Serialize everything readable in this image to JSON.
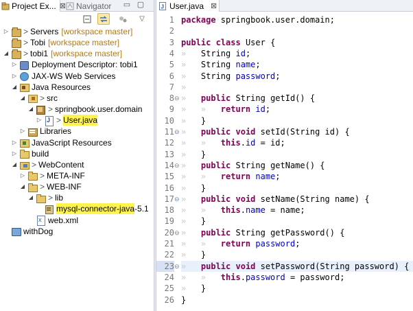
{
  "left_pane": {
    "tabs": [
      {
        "label": "Project Ex...",
        "close": "⊠"
      },
      {
        "label": "Navigator"
      }
    ],
    "window_controls": {
      "minimize": "▭",
      "maximize": "▢"
    },
    "toolbar": {
      "collapse_all": "⊟",
      "link_with_editor": "⇆",
      "menu": "▽"
    },
    "tree": [
      {
        "label": "Servers",
        "prefix": "> ",
        "suffix": "[workspace master]",
        "icon": "project-icon",
        "twisty": "▷",
        "depth": 0
      },
      {
        "label": "Tobi",
        "prefix": "> ",
        "suffix": "[workspace master]",
        "icon": "project-icon",
        "twisty": "",
        "depth": 0
      },
      {
        "label": "tobi1",
        "prefix": "> ",
        "suffix": "[workspace master]",
        "icon": "project-icon",
        "twisty": "◢",
        "depth": 0
      },
      {
        "label": "Deployment Descriptor: tobi1",
        "icon": "deployment-descriptor-icon",
        "twisty": "▷",
        "depth": 1
      },
      {
        "label": "JAX-WS Web Services",
        "icon": "web-services-icon",
        "twisty": "▷",
        "depth": 1
      },
      {
        "label": "Java Resources",
        "icon": "java-resources-icon",
        "twisty": "◢",
        "depth": 1
      },
      {
        "label": "src",
        "prefix": "> ",
        "icon": "source-folder-icon",
        "twisty": "◢",
        "depth": 2
      },
      {
        "label": "springbook.user.domain",
        "prefix": "> ",
        "icon": "package-icon",
        "twisty": "◢",
        "depth": 3
      },
      {
        "label": "User.java",
        "prefix": "> ",
        "icon": "java-file-icon",
        "twisty": "▷",
        "depth": 4,
        "highlight": true
      },
      {
        "label": "Libraries",
        "icon": "libraries-icon",
        "twisty": "▷",
        "depth": 2
      },
      {
        "label": "JavaScript Resources",
        "icon": "javascript-resources-icon",
        "twisty": "▷",
        "depth": 1
      },
      {
        "label": "build",
        "icon": "folder-icon",
        "twisty": "▷",
        "depth": 1
      },
      {
        "label": "WebContent",
        "prefix": "> ",
        "icon": "web-folder-icon",
        "twisty": "◢",
        "depth": 1
      },
      {
        "label": "META-INF",
        "prefix": "> ",
        "icon": "folder-icon",
        "twisty": "▷",
        "depth": 2
      },
      {
        "label": "WEB-INF",
        "prefix": "> ",
        "icon": "folder-icon",
        "twisty": "◢",
        "depth": 2
      },
      {
        "label": "lib",
        "prefix": "> ",
        "icon": "folder-icon",
        "twisty": "◢",
        "depth": 3
      },
      {
        "label": "mysql-connector-java",
        "suffix": "-5.1",
        "icon": "jar-icon",
        "twisty": "",
        "depth": 4,
        "highlight": true
      },
      {
        "label": "web.xml",
        "icon": "xml-file-icon",
        "twisty": "",
        "depth": 3
      },
      {
        "label": "withDog",
        "icon": "withdog-project-icon",
        "twisty": "",
        "depth": 0
      }
    ]
  },
  "editor": {
    "tab": {
      "label": "User.java",
      "close": "⊠"
    },
    "current_line": 23,
    "lines": [
      {
        "n": "1",
        "code": [
          [
            "kw",
            "package"
          ],
          [
            "",
            " springbook.user.domain;"
          ]
        ]
      },
      {
        "n": "2",
        "code": []
      },
      {
        "n": "3",
        "code": [
          [
            "kw",
            "public"
          ],
          [
            "",
            " "
          ],
          [
            "kw",
            "class"
          ],
          [
            "",
            " User {"
          ]
        ]
      },
      {
        "n": "4",
        "code": [
          [
            "ws",
            "»   "
          ],
          [
            "",
            "String "
          ],
          [
            "fd",
            "id"
          ],
          [
            "",
            ";"
          ]
        ]
      },
      {
        "n": "5",
        "code": [
          [
            "ws",
            "»   "
          ],
          [
            "",
            "String "
          ],
          [
            "fd",
            "name"
          ],
          [
            "",
            ";"
          ]
        ]
      },
      {
        "n": "6",
        "code": [
          [
            "ws",
            "»   "
          ],
          [
            "",
            "String "
          ],
          [
            "fd",
            "password"
          ],
          [
            "",
            ";"
          ]
        ]
      },
      {
        "n": "7",
        "code": [
          [
            "ws",
            "»   "
          ]
        ]
      },
      {
        "n": "8",
        "fold": "⊖",
        "code": [
          [
            "ws",
            "»   "
          ],
          [
            "kw",
            "public"
          ],
          [
            "",
            " String getId() {"
          ]
        ]
      },
      {
        "n": "9",
        "code": [
          [
            "ws",
            "»   »   "
          ],
          [
            "kw",
            "return"
          ],
          [
            "",
            " "
          ],
          [
            "fd",
            "id"
          ],
          [
            "",
            ";"
          ]
        ]
      },
      {
        "n": "10",
        "code": [
          [
            "ws",
            "»   "
          ],
          [
            "",
            "}"
          ]
        ]
      },
      {
        "n": "11",
        "fold": "⊖",
        "code": [
          [
            "ws",
            "»   "
          ],
          [
            "kw",
            "public"
          ],
          [
            "",
            " "
          ],
          [
            "kw",
            "void"
          ],
          [
            "",
            " setId(String id) {"
          ]
        ]
      },
      {
        "n": "12",
        "code": [
          [
            "ws",
            "»   »   "
          ],
          [
            "kw",
            "this"
          ],
          [
            "",
            "."
          ],
          [
            "fd",
            "id"
          ],
          [
            "",
            " = id;"
          ]
        ]
      },
      {
        "n": "13",
        "code": [
          [
            "ws",
            "»   "
          ],
          [
            "",
            "}"
          ]
        ]
      },
      {
        "n": "14",
        "fold": "⊖",
        "code": [
          [
            "ws",
            "»   "
          ],
          [
            "kw",
            "public"
          ],
          [
            "",
            " String getName() {"
          ]
        ]
      },
      {
        "n": "15",
        "code": [
          [
            "ws",
            "»   »   "
          ],
          [
            "kw",
            "return"
          ],
          [
            "",
            " "
          ],
          [
            "fd",
            "name"
          ],
          [
            "",
            ";"
          ]
        ]
      },
      {
        "n": "16",
        "code": [
          [
            "ws",
            "»   "
          ],
          [
            "",
            "}"
          ]
        ]
      },
      {
        "n": "17",
        "fold": "⊖",
        "code": [
          [
            "ws",
            "»   "
          ],
          [
            "kw",
            "public"
          ],
          [
            "",
            " "
          ],
          [
            "kw",
            "void"
          ],
          [
            "",
            " setName(String name) {"
          ]
        ]
      },
      {
        "n": "18",
        "code": [
          [
            "ws",
            "»   »   "
          ],
          [
            "kw",
            "this"
          ],
          [
            "",
            "."
          ],
          [
            "fd",
            "name"
          ],
          [
            "",
            " = name;"
          ]
        ]
      },
      {
        "n": "19",
        "code": [
          [
            "ws",
            "»   "
          ],
          [
            "",
            "}"
          ]
        ]
      },
      {
        "n": "20",
        "fold": "⊖",
        "code": [
          [
            "ws",
            "»   "
          ],
          [
            "kw",
            "public"
          ],
          [
            "",
            " String getPassword() {"
          ]
        ]
      },
      {
        "n": "21",
        "code": [
          [
            "ws",
            "»   »   "
          ],
          [
            "kw",
            "return"
          ],
          [
            "",
            " "
          ],
          [
            "fd",
            "password"
          ],
          [
            "",
            ";"
          ]
        ]
      },
      {
        "n": "22",
        "code": [
          [
            "ws",
            "»   "
          ],
          [
            "",
            "}"
          ]
        ]
      },
      {
        "n": "23",
        "fold": "⊖",
        "code": [
          [
            "ws",
            "»   "
          ],
          [
            "kw",
            "public"
          ],
          [
            "",
            " "
          ],
          [
            "kw",
            "void"
          ],
          [
            "",
            " setPassword(String password) {"
          ]
        ]
      },
      {
        "n": "24",
        "code": [
          [
            "ws",
            "»   »   "
          ],
          [
            "kw",
            "this"
          ],
          [
            "",
            "."
          ],
          [
            "fd",
            "password"
          ],
          [
            "",
            " = password;"
          ]
        ]
      },
      {
        "n": "25",
        "code": [
          [
            "ws",
            "»   "
          ],
          [
            "",
            "}"
          ]
        ]
      },
      {
        "n": "26",
        "code": [
          [
            "",
            "}"
          ]
        ]
      }
    ]
  },
  "colors": {
    "keyword": "#7f0055",
    "field": "#0000c0",
    "workspace": "#b07a1a",
    "highlight": "#fff44f",
    "line_number": "#787878"
  }
}
